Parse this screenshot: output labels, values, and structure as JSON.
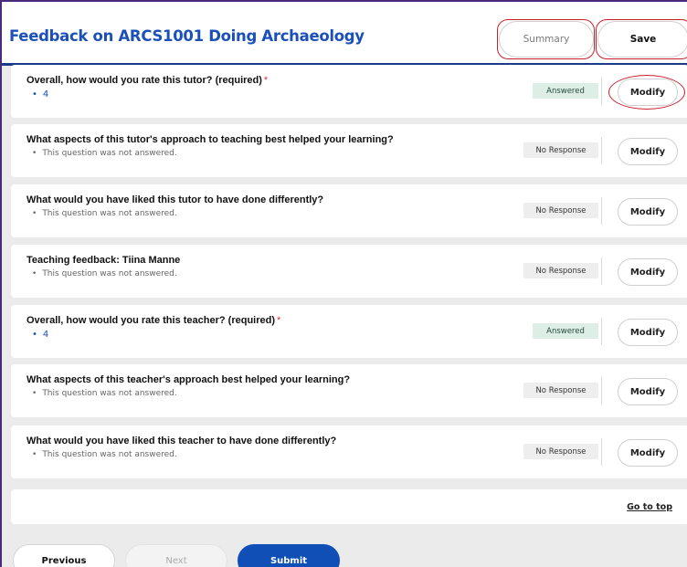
{
  "header": {
    "title": "Feedback on ARCS1001 Doing Archaeology",
    "summary_label": "Summary",
    "save_label": "Save"
  },
  "questions": [
    {
      "text": "Overall, how would you rate this tutor? (required)",
      "required_mark": "*",
      "answer": "4",
      "status": "Answered",
      "modify_label": "Modify"
    },
    {
      "text": "What aspects of this tutor's approach to teaching best helped your learning?",
      "required_mark": "",
      "answer": "This question was not answered.",
      "status": "No Response",
      "modify_label": "Modify"
    },
    {
      "text": "What would you have liked this tutor to have done differently?",
      "required_mark": "",
      "answer": "This question was not answered.",
      "status": "No Response",
      "modify_label": "Modify"
    },
    {
      "text": "Teaching feedback: Tiina Manne",
      "required_mark": "",
      "answer": "This question was not answered.",
      "status": "No Response",
      "modify_label": "Modify"
    },
    {
      "text": "Overall, how would you rate this teacher? (required)",
      "required_mark": "*",
      "answer": "4",
      "status": "Answered",
      "modify_label": "Modify"
    },
    {
      "text": "What aspects of this teacher's approach best helped your learning?",
      "required_mark": "",
      "answer": "This question was not answered.",
      "status": "No Response",
      "modify_label": "Modify"
    },
    {
      "text": "What would you have liked this teacher to have done differently?",
      "required_mark": "",
      "answer": "This question was not answered.",
      "status": "No Response",
      "modify_label": "Modify"
    }
  ],
  "footer": {
    "go_to_top_label": "Go to top",
    "previous_label": "Previous",
    "next_label": "Next",
    "submit_label": "Submit"
  },
  "colors": {
    "accent": "#1a50b8",
    "submit": "#0f4fb6",
    "annotation_ring": "#cc1f2e",
    "answered_badge": "#dceee6"
  }
}
